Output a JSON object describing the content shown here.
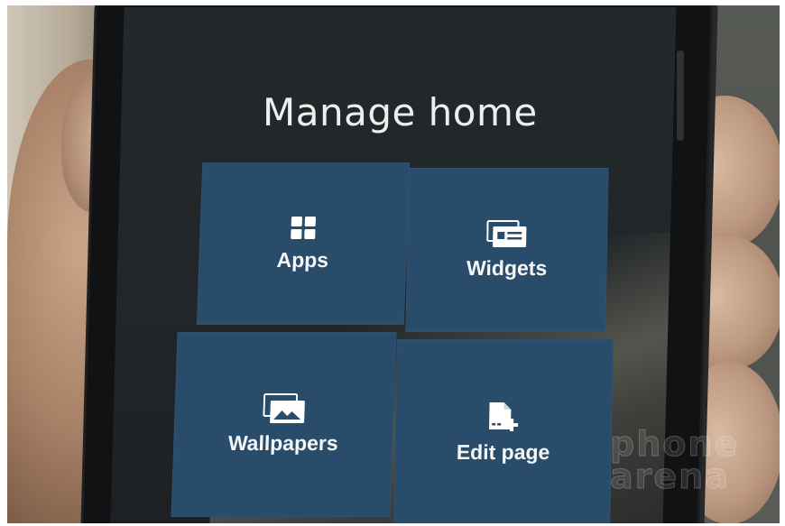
{
  "screen": {
    "title": "Manage home"
  },
  "tiles": [
    {
      "label": "Apps",
      "icon": "grid-icon"
    },
    {
      "label": "Widgets",
      "icon": "widgets-icon"
    },
    {
      "label": "Wallpapers",
      "icon": "wallpaper-icon"
    },
    {
      "label": "Edit page",
      "icon": "add-page-icon"
    }
  ],
  "watermark": {
    "line1": "phone",
    "line2": "arena"
  },
  "colors": {
    "tile_background": "#2a4c6b",
    "screen_background": "#23282c",
    "text": "#ffffff"
  }
}
